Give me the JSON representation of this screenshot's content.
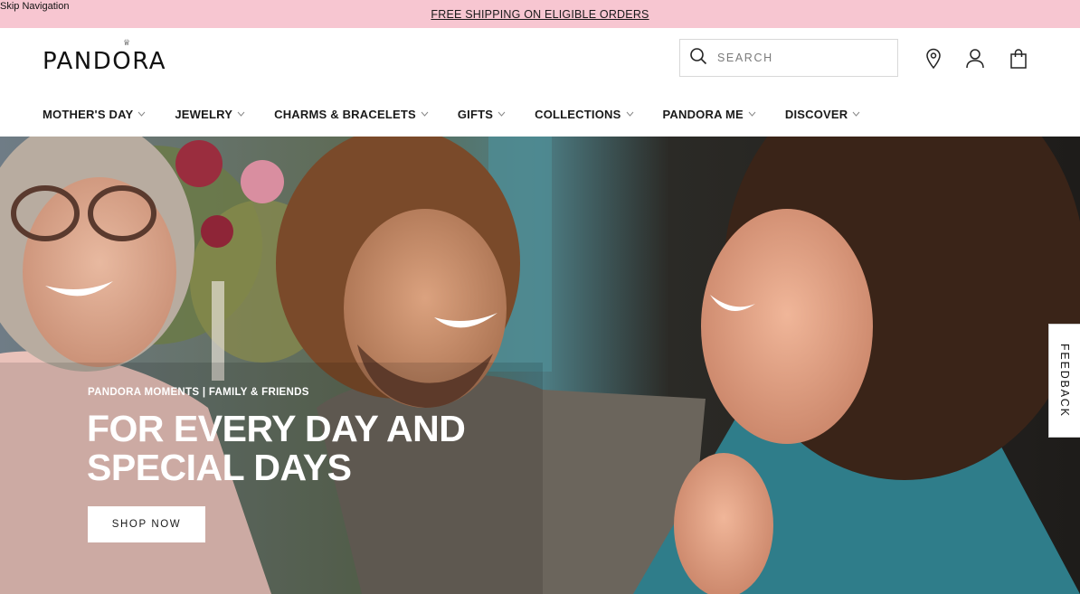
{
  "skip_nav": "Skip Navigation",
  "promo": {
    "text": "FREE SHIPPING ON ELIGIBLE ORDERS"
  },
  "header": {
    "logo": "PANDORA",
    "search": {
      "placeholder": "SEARCH",
      "icon": "search-icon"
    },
    "icons": [
      "location-pin-icon",
      "account-icon",
      "shopping-bag-icon"
    ]
  },
  "nav": {
    "items": [
      {
        "label": "MOTHER'S DAY"
      },
      {
        "label": "JEWELRY"
      },
      {
        "label": "CHARMS & BRACELETS"
      },
      {
        "label": "GIFTS"
      },
      {
        "label": "COLLECTIONS"
      },
      {
        "label": "PANDORA ME"
      },
      {
        "label": "DISCOVER"
      }
    ]
  },
  "hero": {
    "eyebrow": "PANDORA MOMENTS | FAMILY & FRIENDS",
    "title": "FOR EVERY DAY AND SPECIAL DAYS",
    "cta": "SHOP NOW"
  },
  "feedback": {
    "label": "FEEDBACK"
  },
  "colors": {
    "promo_bg": "#f7c6d1",
    "text": "#1a1a1a"
  }
}
